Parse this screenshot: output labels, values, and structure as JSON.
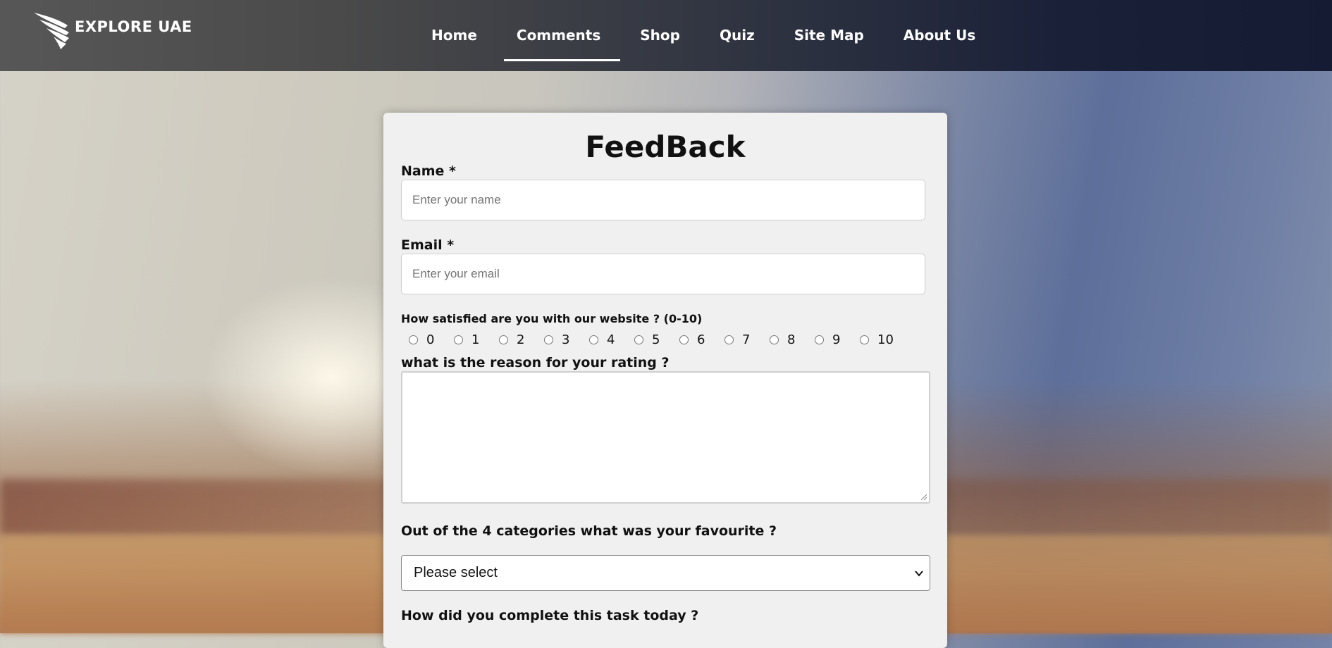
{
  "header": {
    "logo_text": "EXPLORE UAE",
    "logo_icon": "wing-icon",
    "nav": [
      {
        "label": "Home",
        "active": false
      },
      {
        "label": "Comments",
        "active": true
      },
      {
        "label": "Shop",
        "active": false
      },
      {
        "label": "Quiz",
        "active": false
      },
      {
        "label": "Site Map",
        "active": false
      },
      {
        "label": "About Us",
        "active": false
      }
    ]
  },
  "form": {
    "title": "FeedBack",
    "name": {
      "label": "Name *",
      "value": "",
      "placeholder": "Enter your name"
    },
    "email": {
      "label": "Email *",
      "value": "",
      "placeholder": "Enter your email"
    },
    "satisfaction": {
      "label": "How satisfied are you with our website ? (0-10)",
      "options": [
        "0",
        "1",
        "2",
        "3",
        "4",
        "5",
        "6",
        "7",
        "8",
        "9",
        "10"
      ],
      "selected": null
    },
    "reason": {
      "label": "what is the reason for your rating ?",
      "value": ""
    },
    "favourite": {
      "label": "Out of the 4 categories what was your favourite ?",
      "selected": "Please select"
    },
    "task": {
      "label": "How did you complete this task today ?"
    }
  },
  "colors": {
    "header_start": "#575757",
    "header_end": "#151b33",
    "card_bg": "#f0f0f0",
    "nav_text": "#ffffff"
  }
}
